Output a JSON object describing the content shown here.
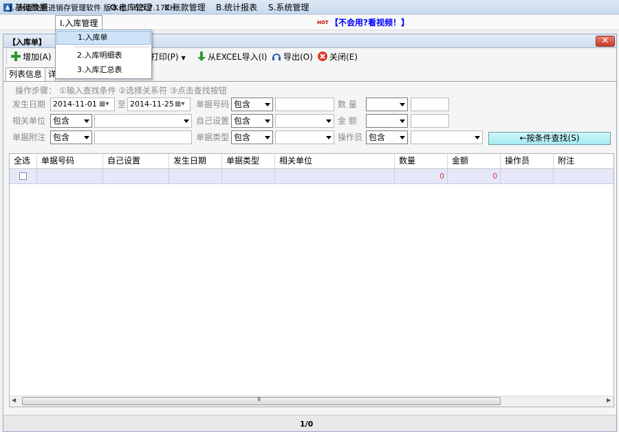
{
  "window": {
    "title": "创管免费进销存管理软件 版本号：6.5.7.172H"
  },
  "menubar": {
    "items": [
      "J.基础数据",
      "I.入库管理",
      "O.出库管理",
      "K.账款管理",
      "B.统计报表",
      "S.系统管理"
    ],
    "hot_badge": "HOT",
    "help_link": "【不会用?看视频！】"
  },
  "dropdown": {
    "items": [
      "1.入库单",
      "2.入库明细表",
      "3.入库汇总表"
    ]
  },
  "child_window": {
    "title": "【入库单】",
    "close": "✕"
  },
  "toolbar": {
    "add": "增加(A)",
    "print": "打印(P)",
    "excel_import": "从EXCEL导入(I)",
    "export": "导出(O)",
    "close": "关闭(E)"
  },
  "tabs": [
    "列表信息",
    "详"
  ],
  "filter": {
    "steps": "操作步骤：  ①输入查找条件 ②选择关系符 ③点击查找按钮",
    "date_label": "发生日期",
    "date_from": "2014-11-01",
    "date_to_label": "至",
    "date_to": "2014-11-25",
    "doc_no_label": "单据号码",
    "qty_label": "数 量",
    "partner_label": "相关单位",
    "custom_label": "自己设置",
    "amount_label": "金 额",
    "note_label": "单据附注",
    "doc_type_label": "单据类型",
    "operator_label": "操作员",
    "contains": "包含",
    "search_button": "←按条件查找(S)"
  },
  "table": {
    "columns": [
      "全选",
      "单据号码",
      "自己设置",
      "发生日期",
      "单据类型",
      "相关单位",
      "数量",
      "金额",
      "操作员",
      "附注"
    ],
    "rows": [
      {
        "qty": "0",
        "amount": "0"
      }
    ]
  },
  "scroll": {
    "grip": "III"
  },
  "status": {
    "pager": "1/0"
  },
  "colors": {
    "accent_blue": "#0000ff",
    "number_red": "#d83a3a",
    "search_button": "#a5eaf0"
  }
}
